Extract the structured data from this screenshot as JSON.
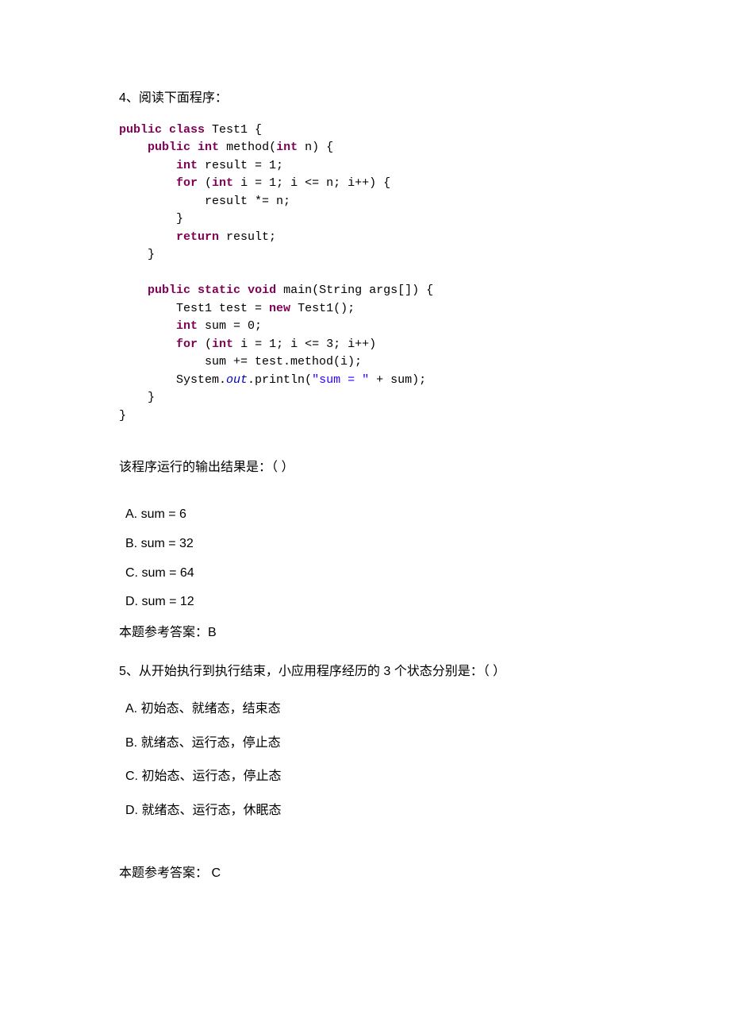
{
  "q4": {
    "stem": "4、阅读下面程序：",
    "code": {
      "l1a": "public",
      "l1b": "class",
      "l1c": " Test1 {",
      "l2a": "public",
      "l2b": "int",
      "l2c": " method(",
      "l2d": "int",
      "l2e": " n) {",
      "l3a": "int",
      "l3b": " result = 1;",
      "l4a": "for",
      "l4b": " (",
      "l4c": "int",
      "l4d": " i = 1; i <= n; i++) {",
      "l5": "result *= n;",
      "l6": "}",
      "l7a": "return",
      "l7b": " result;",
      "l8": "}",
      "l9a": "public",
      "l9b": "static",
      "l9c": "void",
      "l9d": " main(String args[]) {",
      "l10a": "Test1 test = ",
      "l10b": "new",
      "l10c": " Test1();",
      "l11a": "int",
      "l11b": " sum = 0;",
      "l12a": "for",
      "l12b": " (",
      "l12c": "int",
      "l12d": " i = 1; i <= 3; i++)",
      "l13": "sum += test.method(i);",
      "l14a": "System.",
      "l14b": "out",
      "l14c": ".println(",
      "l14d": "\"sum = \"",
      "l14e": " + sum);",
      "l15": "}",
      "l16": "}"
    },
    "result_label": "该程序运行的输出结果是：（     ）",
    "opts": {
      "a": "A. sum = 6",
      "b": "B. sum = 32",
      "c": "C. sum = 64",
      "d": "D. sum = 12"
    },
    "answer": "本题参考答案：B"
  },
  "q5": {
    "stem": "5、从开始执行到执行结束，小应用程序经历的 3 个状态分别是：（     ）",
    "opts": {
      "a": "A. 初始态、就绪态，结束态",
      "b": "B. 就绪态、运行态，停止态",
      "c": "C. 初始态、运行态，停止态",
      "d": "D. 就绪态、运行态，休眠态"
    },
    "answer": "本题参考答案： C"
  }
}
